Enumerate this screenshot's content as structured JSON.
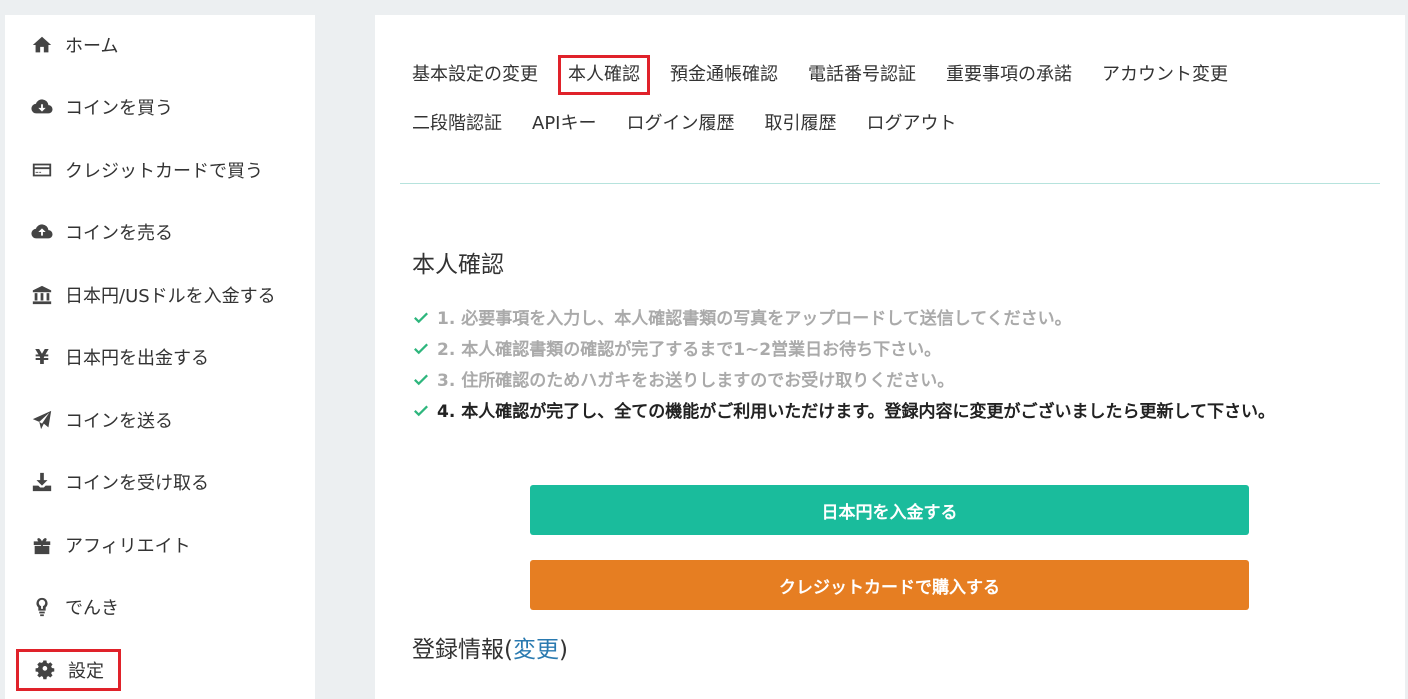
{
  "sidebar": {
    "items": [
      {
        "label": "ホーム",
        "icon": "home-icon"
      },
      {
        "label": "コインを買う",
        "icon": "cloud-download-icon"
      },
      {
        "label": "クレジットカードで買う",
        "icon": "credit-card-icon"
      },
      {
        "label": "コインを売る",
        "icon": "cloud-upload-icon"
      },
      {
        "label": "日本円/USドルを入金する",
        "icon": "bank-icon"
      },
      {
        "label": "日本円を出金する",
        "icon": "yen-icon"
      },
      {
        "label": "コインを送る",
        "icon": "paper-plane-icon"
      },
      {
        "label": "コインを受け取る",
        "icon": "download-icon"
      },
      {
        "label": "アフィリエイト",
        "icon": "gift-icon"
      },
      {
        "label": "でんき",
        "icon": "lightbulb-icon"
      },
      {
        "label": "設定",
        "icon": "gear-icon"
      }
    ]
  },
  "tabs": {
    "row1": [
      "基本設定の変更",
      "本人確認",
      "預金通帳確認",
      "電話番号認証",
      "重要事項の承諾",
      "アカウント変更"
    ],
    "row2": [
      "二段階認証",
      "APIキー",
      "ログイン履歴",
      "取引履歴",
      "ログアウト"
    ]
  },
  "main": {
    "section_title": "本人確認",
    "steps": [
      "1. 必要事項を入力し、本人確認書類の写真をアップロードして送信してください。",
      "2. 本人確認書類の確認が完了するまで1~2営業日お待ち下さい。",
      "3. 住所確認のためハガキをお送りしますのでお受け取りください。",
      "4. 本人確認が完了し、全ての機能がご利用いただけます。登録内容に変更がございましたら更新して下さい。"
    ],
    "deposit_button": "日本円を入金する",
    "credit_button": "クレジットカードで購入する",
    "reg_info_label": "登録情報(",
    "reg_info_link": "変更",
    "reg_info_close": ")"
  },
  "colors": {
    "highlight": "#e0222a",
    "green_button": "#1abc9c",
    "orange_button": "#e67e22",
    "check": "#2eb67d",
    "link": "#2a7ab0"
  }
}
